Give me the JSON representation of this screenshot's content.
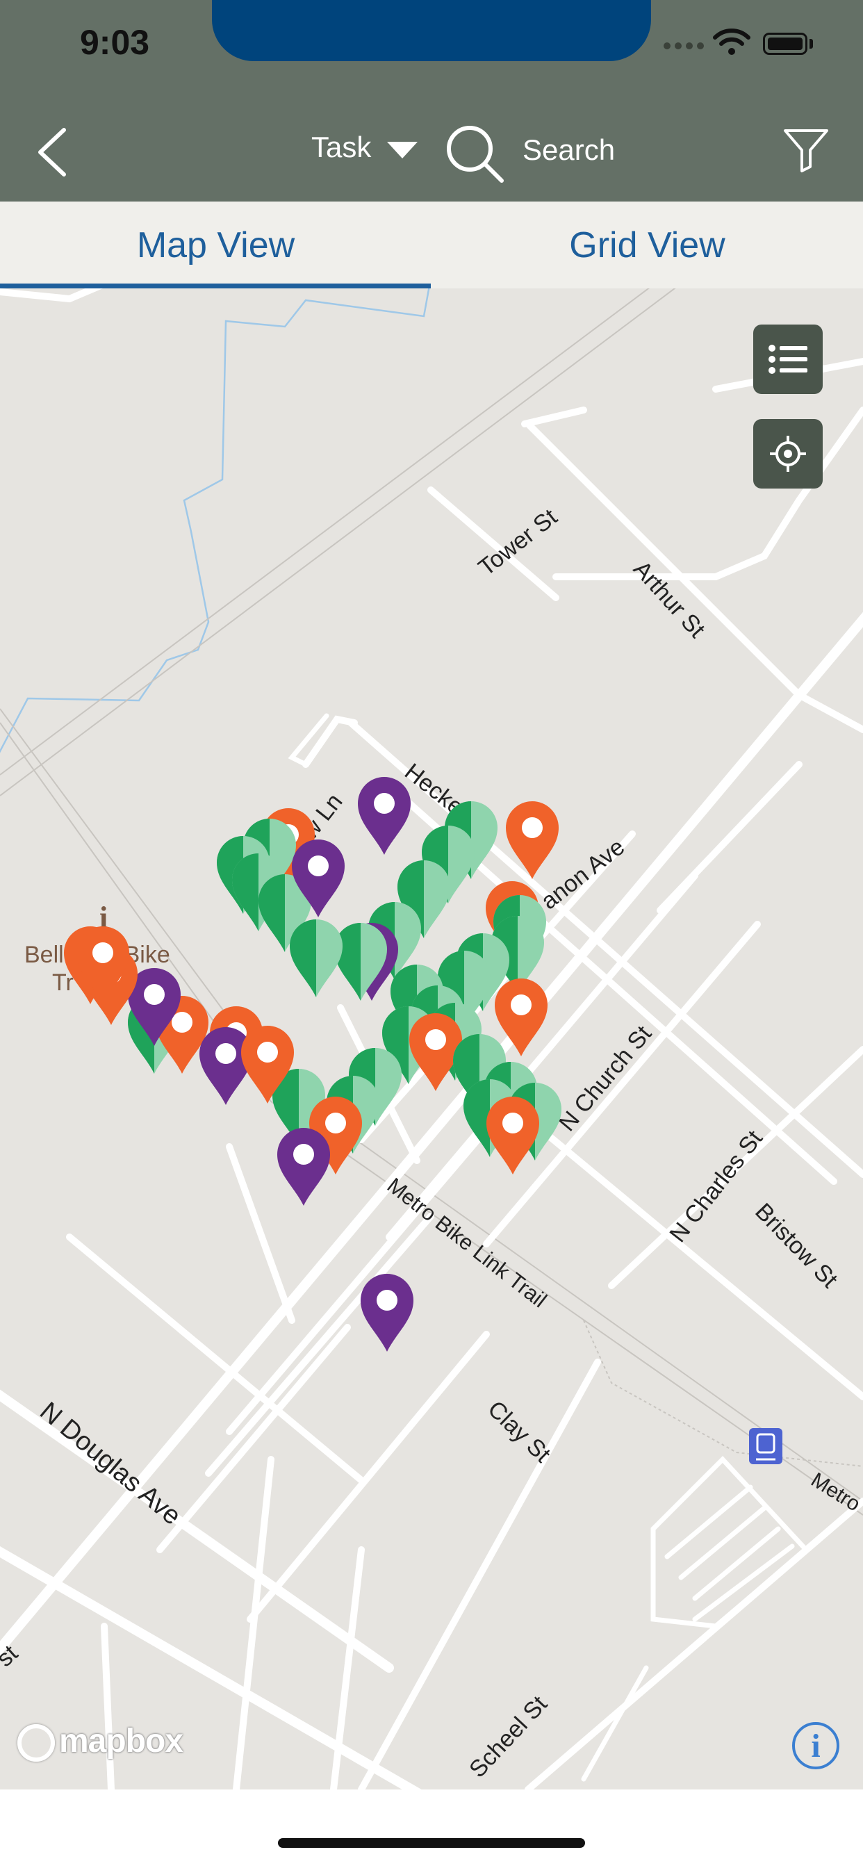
{
  "status_bar": {
    "time": "9:03"
  },
  "header": {
    "task_label": "Task",
    "search_placeholder": "Search"
  },
  "tabs": [
    {
      "label": "Map View",
      "active": true
    },
    {
      "label": "Grid View",
      "active": false
    }
  ],
  "map": {
    "streets": [
      "Tower St",
      "Arthur St",
      "Hecker St",
      "anon Ave",
      "N Church St",
      "N Charles St",
      "Bristow St",
      "Metro Bike Link Trail",
      "Clay St",
      "N Douglas Ave",
      "Scheel St",
      "Metro"
    ],
    "partial_labels": [
      "st",
      "w Ln"
    ],
    "poi": {
      "line1": "Belleville Bike",
      "line2": "Tr  ap"
    },
    "marker_colors": {
      "orange": "#f0622a",
      "purple": "#6b2f8e",
      "green": "#1fa35a",
      "green_light": "#8fd4ad"
    },
    "attribution": "mapbox"
  },
  "colors": {
    "header": "#647066",
    "notch": "#00447c",
    "tab_text": "#1e5f9c"
  }
}
